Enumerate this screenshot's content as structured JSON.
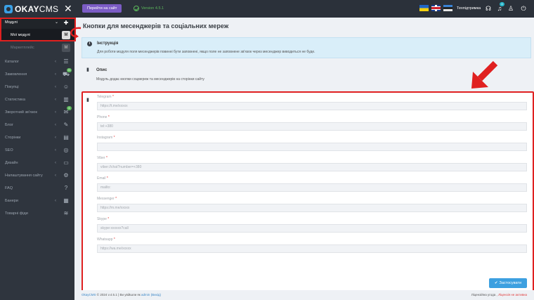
{
  "topbar": {
    "logo_ok": "OKAY",
    "logo_cms": "CMS",
    "goto_site": "Перейти на сайт",
    "version": "Version 4.5.1",
    "support": "Техпідтримка",
    "notification_count": "4"
  },
  "sidebar": {
    "modules": "Модулі",
    "my_modules": "Мої модулі",
    "marketplace": "Маркетплейс",
    "items": [
      {
        "label": "Каталог",
        "icon": "list-icon",
        "badge": ""
      },
      {
        "label": "Замовлення",
        "icon": "cart-icon",
        "badge": "21"
      },
      {
        "label": "Покупці",
        "icon": "users-icon",
        "badge": ""
      },
      {
        "label": "Статистика",
        "icon": "chart-icon",
        "badge": ""
      },
      {
        "label": "Зворотний зв'язок",
        "icon": "chat-icon",
        "badge": "6"
      },
      {
        "label": "Блог",
        "icon": "pencil-icon",
        "badge": ""
      },
      {
        "label": "Сторінки",
        "icon": "window-icon",
        "badge": ""
      },
      {
        "label": "SEO",
        "icon": "target-icon",
        "badge": ""
      },
      {
        "label": "Дизайн",
        "icon": "monitor-icon",
        "badge": ""
      },
      {
        "label": "Налаштування сайту",
        "icon": "gear-icon",
        "badge": ""
      },
      {
        "label": "FAQ",
        "icon": "question-icon",
        "badge": ""
      },
      {
        "label": "Банери",
        "icon": "banner-icon",
        "badge": ""
      },
      {
        "label": "Товарні фіди",
        "icon": "rss-icon",
        "badge": ""
      }
    ]
  },
  "main": {
    "title": "Кнопки для месенджерів та соціальних мереж",
    "instruction_title": "Інструкція",
    "instruction_text": "Для роботи модуля поля месенджерів повинні бути заповнені, якщо поле не заповнене зв'язок через месенджер виводиться не буде.",
    "description_title": "Опис",
    "description_text": "Модуль додає кнопки соцмереж та месенджерів на сторінки сайту",
    "fields": [
      {
        "label": "Telegram",
        "placeholder": "https://t.me/xxxxx"
      },
      {
        "label": "Phone",
        "placeholder": "tel:+380"
      },
      {
        "label": "Instagram",
        "placeholder": ""
      },
      {
        "label": "Viber",
        "placeholder": "viber://chat?number=+380"
      },
      {
        "label": "Email",
        "placeholder": "mailto:"
      },
      {
        "label": "Messenger",
        "placeholder": "https://m.me/xxxxx"
      },
      {
        "label": "Skype",
        "placeholder": "skype:xxxxxx?call"
      },
      {
        "label": "Whatsapp",
        "placeholder": "https://wa.me/xxxxx"
      }
    ],
    "required_mark": "*",
    "apply_button": "Застосувати"
  },
  "footer": {
    "brand": "OkayCMS",
    "copyright": "© 2024 v.4.5.1 | Ви увійшли як",
    "admin": "admin",
    "logout": "(Вихід)",
    "license": "Ліцензійна угода ,",
    "license_warn": "Ліцензія не активна"
  },
  "colors": {
    "accent": "#3da0e0",
    "highlight": "#e02020",
    "sidebar": "#2f353e",
    "topbar": "#2b313a"
  }
}
